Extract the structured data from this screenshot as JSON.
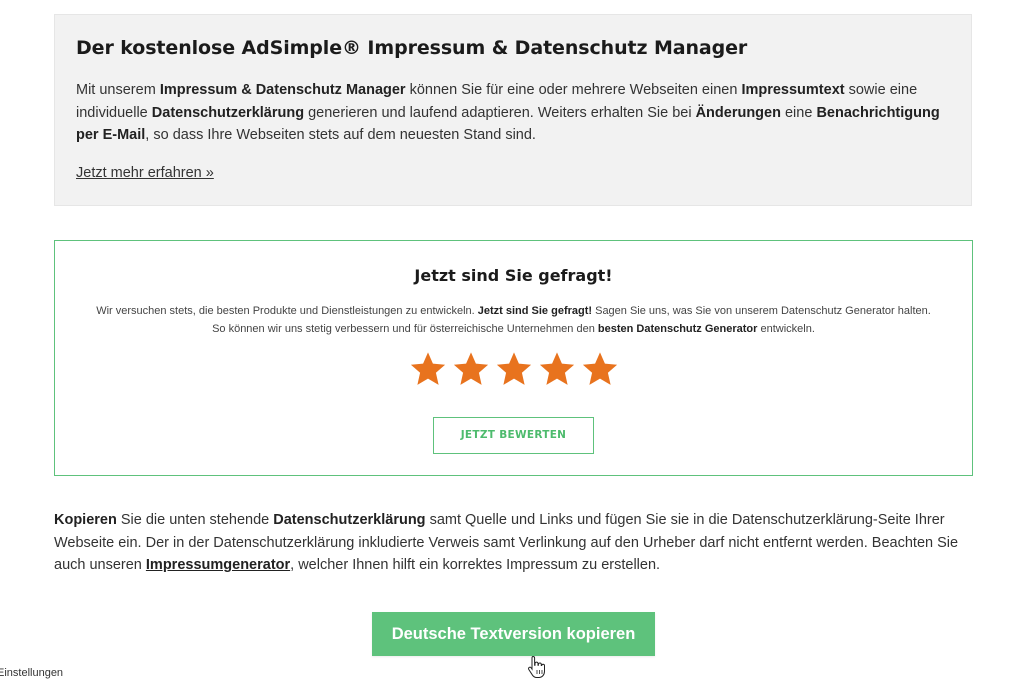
{
  "promo": {
    "title": "Der kostenlose AdSimple® Impressum & Datenschutz Manager",
    "text_1": "Mit unserem ",
    "text_2": "Impressum & Datenschutz Manager",
    "text_3": " können Sie für eine oder mehrere Webseiten einen ",
    "text_4": "Impressumtext",
    "text_5": " sowie eine individuelle ",
    "text_6": "Datenschutzerklärung",
    "text_7": " generieren und laufend adaptieren. Weiters erhalten Sie bei ",
    "text_8": "Änderungen",
    "text_9": " eine ",
    "text_10": "Benachrichtigung per E-Mail",
    "text_11": ", so dass Ihre Webseiten stets auf dem neuesten Stand sind.",
    "link": "Jetzt mehr erfahren »"
  },
  "rating": {
    "title": "Jetzt sind Sie gefragt!",
    "text_1": "Wir versuchen stets, die besten Produkte und Dienstleistungen zu entwickeln. ",
    "text_2": "Jetzt sind Sie gefragt!",
    "text_3": " Sagen Sie uns, was Sie von unserem Datenschutz Generator halten.",
    "text_4": "So können wir uns stetig verbessern und für österreichische Unternehmen den ",
    "text_5": "besten Datenschutz Generator",
    "text_6": " entwickeln.",
    "stars_count": 5,
    "star_color": "#e8731e",
    "button": "JETZT BEWERTEN"
  },
  "instructions": {
    "text_1": "Kopieren",
    "text_2": " Sie die unten stehende ",
    "text_3": "Datenschutzerklärung",
    "text_4": " samt Quelle und Links und fügen Sie sie in die Datenschutzerklärung-Seite Ihrer Webseite ein. Der in der Datenschutzerklärung inkludierte Verweis samt Verlinkung auf den Urheber darf nicht entfernt werden. Beachten Sie auch unseren ",
    "link": "Impressumgenerator",
    "text_5": ", welcher Ihnen hilft ein korrektes Impressum zu erstellen."
  },
  "copy_button": {
    "label": "Deutsche Textversion kopieren",
    "color": "#5ec27c"
  },
  "footer": {
    "settings_label": "Einstellungen"
  },
  "colors": {
    "accent_green": "#5ec27c",
    "star_orange": "#e8731e",
    "promo_bg": "#f2f2f2"
  }
}
